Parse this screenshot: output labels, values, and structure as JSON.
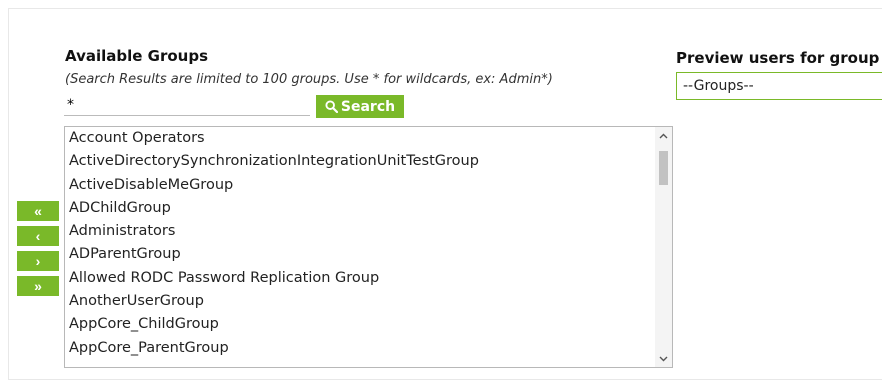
{
  "available_groups": {
    "title": "Available Groups",
    "hint": "(Search Results are limited to 100 groups. Use * for wildcards, ex: Admin*)",
    "search_value": "*",
    "search_button_label": "Search",
    "items": [
      "Account Operators",
      "ActiveDirectorySynchronizationIntegrationUnitTestGroup",
      "ActiveDisableMeGroup",
      "ADChildGroup",
      "Administrators",
      "ADParentGroup",
      "Allowed RODC Password Replication Group",
      "AnotherUserGroup",
      "AppCore_ChildGroup",
      "AppCore_ParentGroup"
    ]
  },
  "move_buttons": {
    "add_all": "«",
    "add_one": "‹",
    "remove_one": "›",
    "remove_all": "»"
  },
  "preview": {
    "title": "Preview users for group",
    "select_value": "--Groups--"
  },
  "colors": {
    "accent_green": "#7ab929"
  },
  "icons": {
    "search": "search-icon",
    "scroll_up": "chevron-up-icon",
    "scroll_down": "chevron-down-icon"
  }
}
